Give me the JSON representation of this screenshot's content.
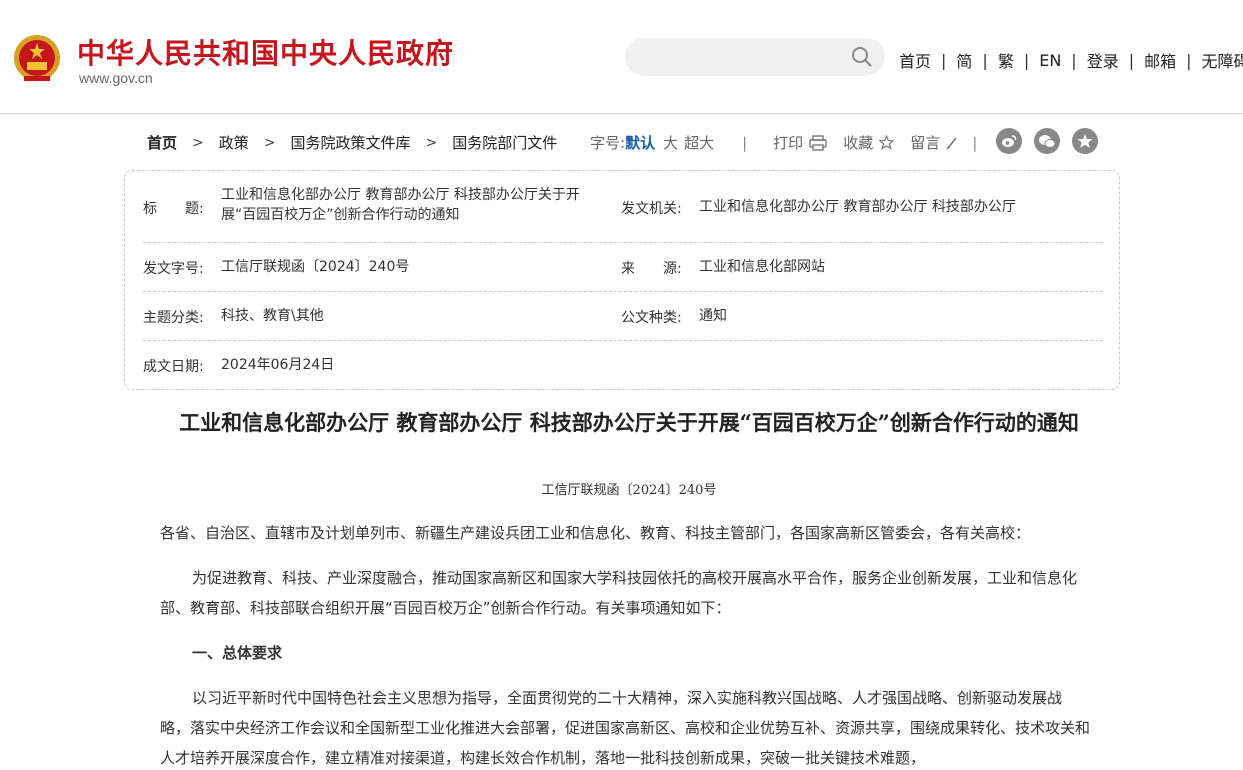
{
  "header": {
    "site_title": "中华人民共和国中央人民政府",
    "site_url": "www.gov.cn",
    "search_placeholder": "",
    "nav": [
      "首页",
      "简",
      "繁",
      "EN",
      "登录",
      "邮箱",
      "无障碍"
    ],
    "brand_color": "#c4161c"
  },
  "breadcrumb": [
    "首页",
    "政策",
    "国务院政策文件库",
    "国务院部门文件"
  ],
  "tools": {
    "font_size_label": "字号:",
    "font_sizes": [
      "默认",
      "大",
      "超大"
    ],
    "print": "打印",
    "favorite": "收藏",
    "comment": "留言",
    "share_icons": [
      "weibo-icon",
      "wechat-icon",
      "star-share-icon"
    ]
  },
  "info": {
    "title_label": "标　　题:",
    "title_value": "工业和信息化部办公厅 教育部办公厅 科技部办公厅关于开展“百园百校万企”创新合作行动的通知",
    "issuer_label": "发文机关:",
    "issuer_value": "工业和信息化部办公厅 教育部办公厅 科技部办公厅",
    "docno_label": "发文字号:",
    "docno_value": "工信厅联规函〔2024〕240号",
    "source_label": "来　　源:",
    "source_value": "工业和信息化部网站",
    "topic_label": "主题分类:",
    "topic_value": "科技、教育\\其他",
    "doctype_label": "公文种类:",
    "doctype_value": "通知",
    "date_label": "成文日期:",
    "date_value": "2024年06月24日"
  },
  "article": {
    "title": "工业和信息化部办公厅 教育部办公厅 科技部办公厅关于开展“百园百校万企”创新合作行动的通知",
    "doc_no": "工信厅联规函〔2024〕240号",
    "salutation": "各省、自治区、直辖市及计划单列市、新疆生产建设兵团工业和信息化、教育、科技主管部门，各国家高新区管委会，各有关高校：",
    "para1": "为促进教育、科技、产业深度融合，推动国家高新区和国家大学科技园依托的高校开展高水平合作，服务企业创新发展，工业和信息化部、教育部、科技部联合组织开展“百园百校万企”创新合作行动。有关事项通知如下：",
    "section1": "一、总体要求",
    "para2": "以习近平新时代中国特色社会主义思想为指导，全面贯彻党的二十大精神，深入实施科教兴国战略、人才强国战略、创新驱动发展战略，落实中央经济工作会议和全国新型工业化推进大会部署，促进国家高新区、高校和企业优势互补、资源共享，围绕成果转化、技术攻关和人才培养开展深度合作，建立精准对接渠道，构建长效合作机制，落地一批科技创新成果，突破一批关键技术难题，"
  }
}
